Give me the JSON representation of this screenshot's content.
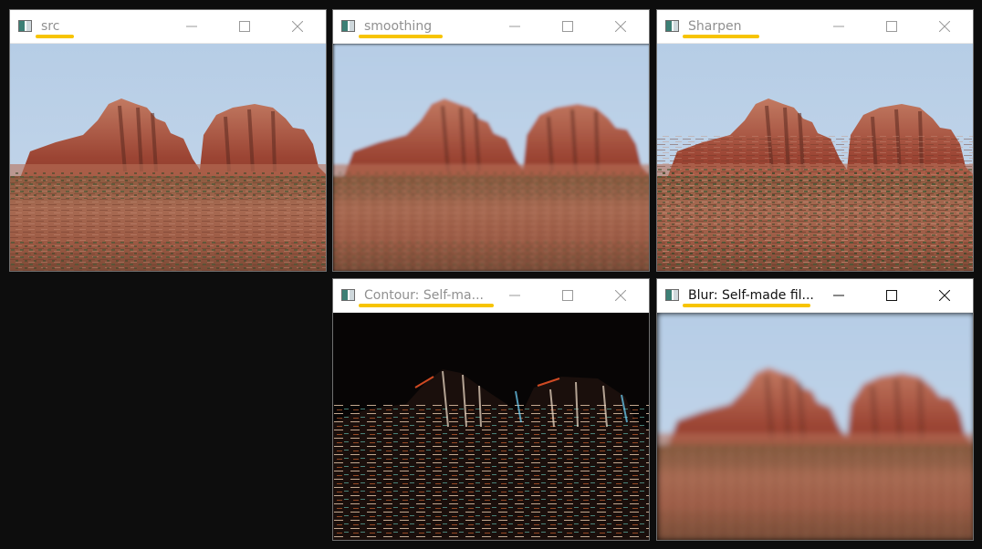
{
  "windows": [
    {
      "id": "src",
      "title": "src",
      "active": false
    },
    {
      "id": "smoothing",
      "title": "smoothing",
      "active": false
    },
    {
      "id": "sharpen",
      "title": "Sharpen",
      "active": false
    },
    {
      "id": "contour",
      "title": "Contour: Self-ma...",
      "active": false
    },
    {
      "id": "blur",
      "title": "Blur: Self-made fil...",
      "active": true
    }
  ],
  "colors": {
    "highlight_underline": "#f7c400",
    "desktop_background": "#0d0d0d",
    "sky": "#b9d2ea",
    "rock": "#9b4b36",
    "ground": "#a0604a"
  },
  "icons": {
    "app": "opencv-window-icon",
    "minimize": "minimize-icon",
    "maximize": "maximize-icon",
    "close": "close-icon"
  }
}
